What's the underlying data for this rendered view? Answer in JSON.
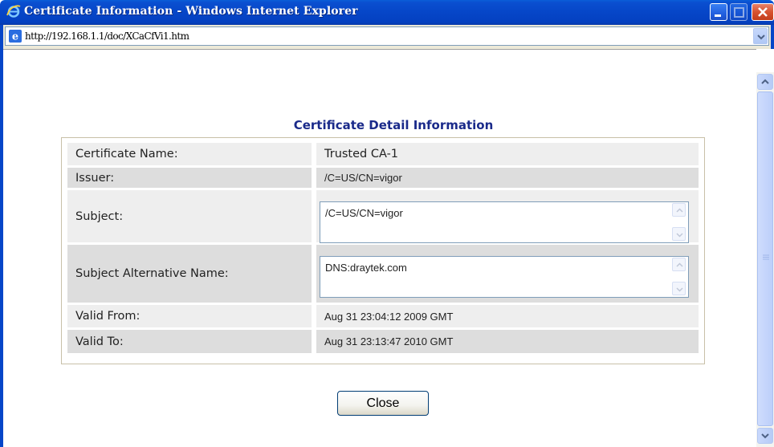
{
  "window": {
    "title": "Certificate Information - Windows Internet Explorer"
  },
  "address": {
    "url": "http://192.168.1.1/doc/XCaCfVi1.htm"
  },
  "page": {
    "heading": "Certificate Detail Information",
    "close_label": "Close"
  },
  "details": {
    "certificate_name_label": "Certificate Name:",
    "certificate_name_value": "Trusted CA-1",
    "issuer_label": "Issuer:",
    "issuer_value": "/C=US/CN=vigor",
    "subject_label": "Subject:",
    "subject_value": "/C=US/CN=vigor",
    "san_label": "Subject Alternative Name:",
    "san_value": "DNS:draytek.com",
    "valid_from_label": "Valid From:",
    "valid_from_value": "Aug 31 23:04:12  2009 GMT",
    "valid_to_label": "Valid To:",
    "valid_to_value": "Aug 31 23:13:47  2010 GMT"
  },
  "colors": {
    "title_bar": "#0646c8",
    "heading": "#1a2a8a",
    "row_light": "#eeeeee",
    "row_dark": "#dddddd"
  },
  "icons": [
    "ie-logo-icon",
    "minimize-icon",
    "maximize-icon",
    "close-icon",
    "chevron-down-icon",
    "scroll-up-icon",
    "scroll-down-icon"
  ]
}
